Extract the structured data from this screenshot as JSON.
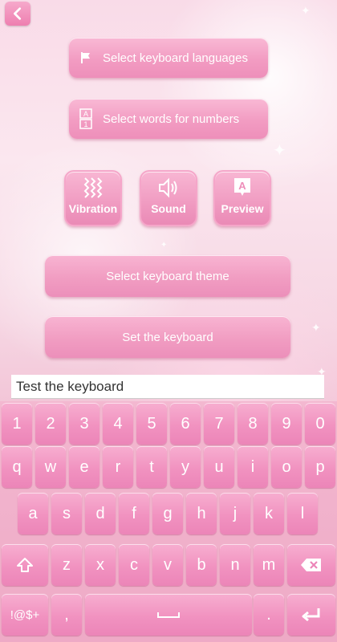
{
  "settings": {
    "languages_label": "Select keyboard languages",
    "words_label": "Select words for numbers",
    "vibration_label": "Vibration",
    "sound_label": "Sound",
    "preview_label": "Preview",
    "theme_label": "Select keyboard theme",
    "set_label": "Set the keyboard"
  },
  "test_input": {
    "value": "Test the keyboard"
  },
  "keyboard": {
    "numbers": [
      "1",
      "2",
      "3",
      "4",
      "5",
      "6",
      "7",
      "8",
      "9",
      "0"
    ],
    "row1": [
      "q",
      "w",
      "e",
      "r",
      "t",
      "y",
      "u",
      "i",
      "o",
      "p"
    ],
    "row2": [
      "a",
      "s",
      "d",
      "f",
      "g",
      "h",
      "j",
      "k",
      "l"
    ],
    "row3": [
      "z",
      "x",
      "c",
      "v",
      "b",
      "n",
      "m"
    ],
    "symbols_label": "!@$+",
    "comma_label": ",",
    "period_label": "."
  },
  "colors": {
    "accent": "#ee8fba",
    "text": "#ffffff"
  },
  "icons": [
    "back-arrow-icon",
    "flag-icon",
    "a1-icon",
    "vibration-icon",
    "sound-icon",
    "preview-icon",
    "shift-icon",
    "backspace-icon",
    "space-icon",
    "enter-icon"
  ]
}
